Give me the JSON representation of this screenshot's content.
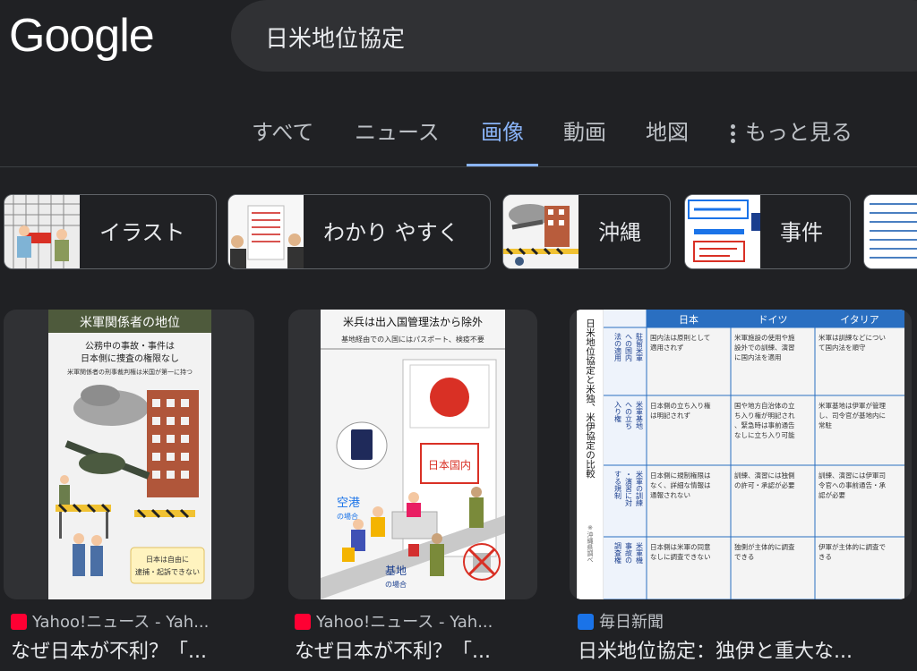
{
  "logo": "Google",
  "search": {
    "query": "日米地位協定"
  },
  "tabs": [
    {
      "label": "すべて"
    },
    {
      "label": "ニュース"
    },
    {
      "label": "画像"
    },
    {
      "label": "動画"
    },
    {
      "label": "地図"
    },
    {
      "label": "もっと見る"
    }
  ],
  "chips": [
    {
      "label": "イラスト"
    },
    {
      "label": "わかり やすく"
    },
    {
      "label": "沖縄"
    },
    {
      "label": "事件"
    }
  ],
  "results": [
    {
      "source": "Yahoo!ニュース - Yah...",
      "title": "なぜ日本が不利？「...",
      "img_title": "米軍関係者の地位",
      "img_sub1": "公務中の事故・事件は",
      "img_sub2": "日本側に捜査の権限なし",
      "img_sub3": "米軍関係者の刑事裁判権は米国が第一に持つ",
      "img_note1": "日本は自由に",
      "img_note2": "逮捕・起訴できない"
    },
    {
      "source": "Yahoo!ニュース - Yah...",
      "title": "なぜ日本が不利？「...",
      "img_title": "米兵は出入国管理法から除外",
      "img_sub": "基地経由での入国にはパスポート、検疫不要",
      "img_gate": "日本国内",
      "img_airport1": "空港",
      "img_airport2": "の場合",
      "img_base1": "基地",
      "img_base2": "の場合"
    },
    {
      "source": "毎日新聞",
      "title": "日米地位協定：独伊と重大な...",
      "img_heading": "日米地位協定と米独、米伊協定の比較",
      "img_note": "※沖縄県調べ",
      "table_headers": [
        "日本",
        "ドイツ",
        "イタリア"
      ],
      "table_rows": [
        {
          "head": "駐留米軍への国内法の適用",
          "cells": [
            "国内法は原則として適用されず",
            "米軍施設の使用や施設外での訓練、演習に国内法を適用",
            "米軍は訓練などについて国内法を順守"
          ]
        },
        {
          "head": "米軍基地への立ち入り権",
          "cells": [
            "日本側の立ち入り権は明記されず",
            "国や地方自治体の立ち入り権が明記され、緊急時は事前通告なしに立ち入り可能",
            "米軍基地は伊軍が管理し、司令官が基地内に常駐"
          ]
        },
        {
          "head": "米軍の訓練・演習に対する規制",
          "cells": [
            "日本側に規制権限はなく、詳細な情報は通報されない",
            "訓練、演習には独側の許可・承認が必要",
            "訓練、演習には伊軍司令官への事前通告・承認が必要"
          ]
        },
        {
          "head": "米軍機事故の調査権",
          "cells": [
            "日本側は米軍の同意なしに調査できない",
            "独側が主体的に調査できる",
            "伊軍が主体的に調査できる"
          ]
        }
      ]
    }
  ],
  "partial_chip": {}
}
